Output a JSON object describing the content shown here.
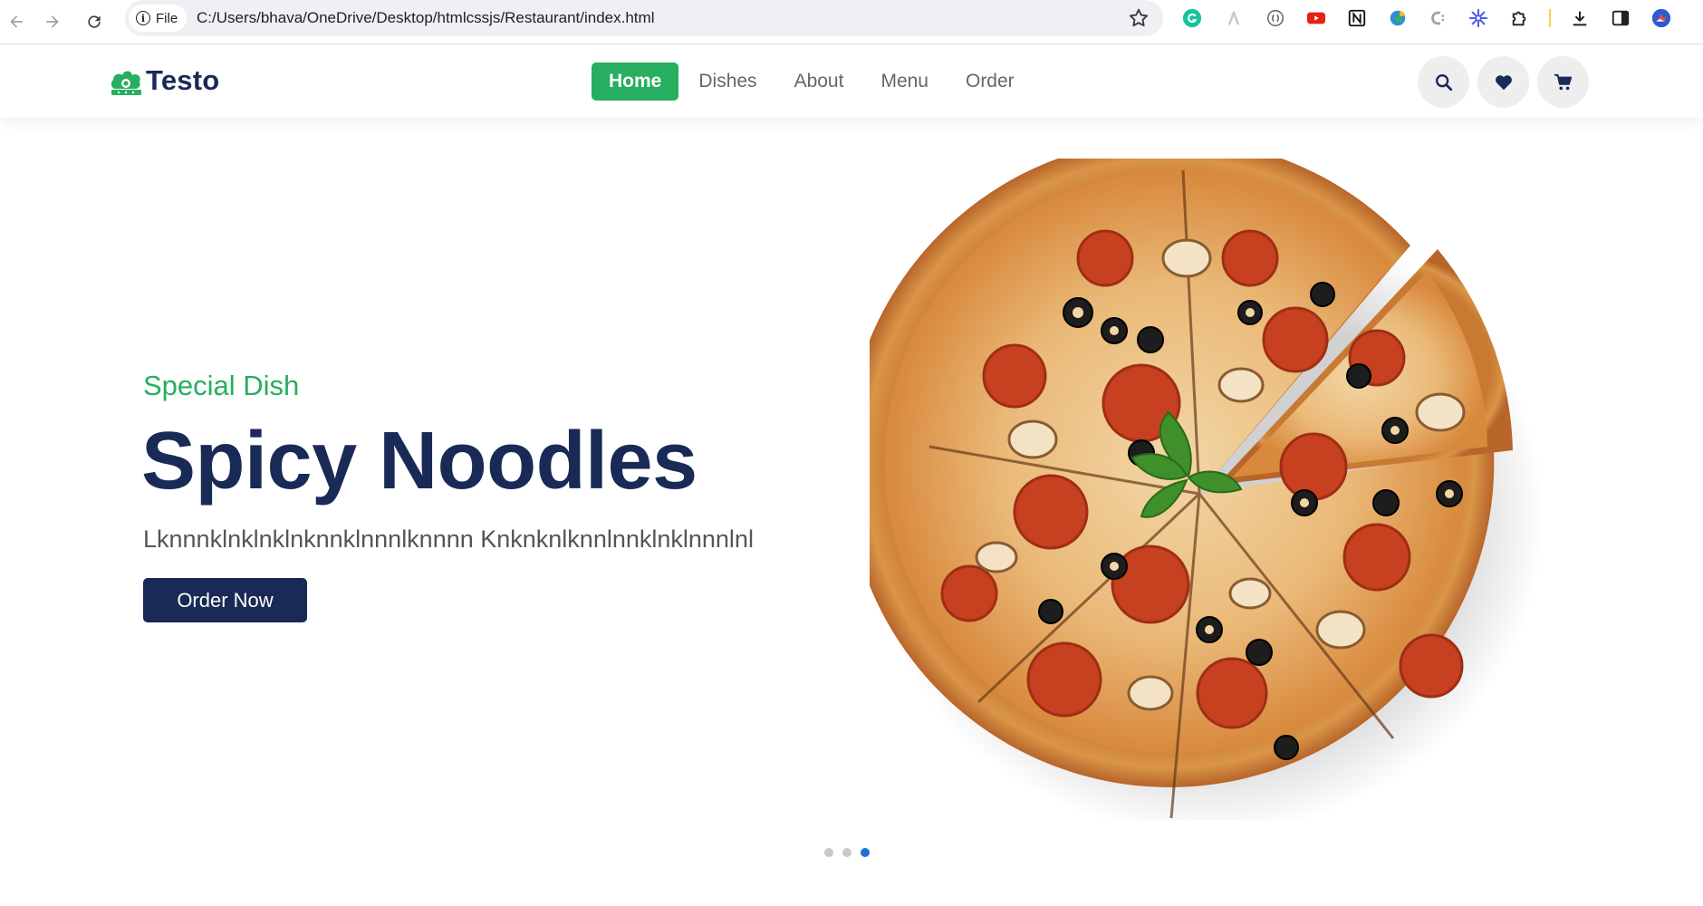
{
  "browser": {
    "url_chip": "File",
    "url": "C:/Users/bhava/OneDrive/Desktop/htmlcssjs/Restaurant/index.html",
    "extensions": [
      "grammarly-icon",
      "a-icon",
      "bracket-circle-icon",
      "youtube-icon",
      "notion-icon",
      "globe-icon",
      "c-icon",
      "snowflake-icon",
      "puzzle-icon",
      "download-icon",
      "sidebar-icon",
      "profile-avatar"
    ]
  },
  "header": {
    "logo_text": "Testo",
    "nav": [
      {
        "label": "Home",
        "active": true
      },
      {
        "label": "Dishes",
        "active": false
      },
      {
        "label": "About",
        "active": false
      },
      {
        "label": "Menu",
        "active": false
      },
      {
        "label": "Order",
        "active": false
      }
    ],
    "icons": [
      "search-icon",
      "heart-icon",
      "cart-icon"
    ]
  },
  "hero": {
    "subtitle": "Special Dish",
    "title": "Spicy Noodles",
    "text": "Lknnnklnklnklnknnklnnnlknnnn Knknknlknnlnnklnklnnnlnl",
    "button": "Order Now",
    "slides": 3,
    "active_slide": 3
  },
  "colors": {
    "accent": "#27ae60",
    "primary": "#192a56",
    "slider_active": "#1b6fd8"
  }
}
